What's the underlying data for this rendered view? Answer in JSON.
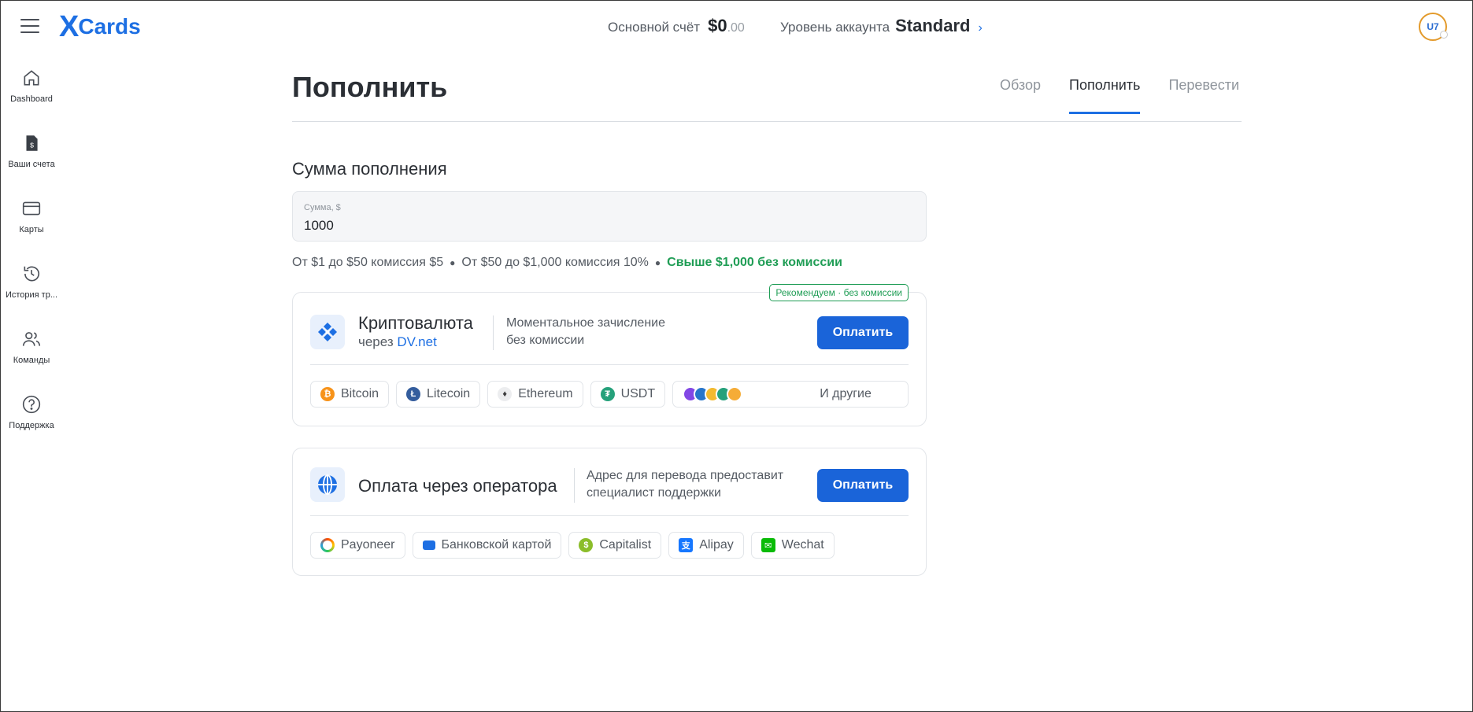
{
  "header": {
    "logo_x": "X",
    "logo_text": "Cards",
    "balance_label": "Основной счёт",
    "balance_amount": "$0",
    "balance_cents": ".00",
    "level_label": "Уровень аккаунта",
    "level_value": "Standard",
    "avatar": "U7"
  },
  "sidebar": {
    "items": [
      {
        "label": "Dashboard",
        "icon": "home-icon"
      },
      {
        "label": "Ваши счета",
        "icon": "invoice-icon"
      },
      {
        "label": "Карты",
        "icon": "card-icon"
      },
      {
        "label": "История тр...",
        "icon": "history-icon"
      },
      {
        "label": "Команды",
        "icon": "team-icon"
      },
      {
        "label": "Поддержка",
        "icon": "help-icon"
      }
    ]
  },
  "page": {
    "title": "Пополнить",
    "tabs": [
      {
        "label": "Обзор",
        "active": false
      },
      {
        "label": "Пополнить",
        "active": true
      },
      {
        "label": "Перевести",
        "active": false
      }
    ]
  },
  "amount": {
    "section_title": "Сумма пополнения",
    "field_label": "Сумма, $",
    "field_value": "1000",
    "fee_1": "От $1 до $50 комиссия $5",
    "fee_2": "От $50 до $1,000 комиссия 10%",
    "fee_3": "Свыше $1,000 без комиссии"
  },
  "crypto": {
    "badge": "Рекомендуем · без комиссии",
    "title": "Криптовалюта",
    "via": "через",
    "via_link": "DV.net",
    "desc_1": "Моментальное зачисление",
    "desc_2": "без комиссии",
    "button": "Оплатить",
    "chips": [
      "Bitcoin",
      "Litecoin",
      "Ethereum",
      "USDT"
    ],
    "more": "И другие"
  },
  "operator": {
    "title": "Оплата через оператора",
    "desc_1": "Адрес для перевода предоставит",
    "desc_2": "специалист поддержки",
    "button": "Оплатить",
    "chips": [
      "Payoneer",
      "Банковской картой",
      "Capitalist",
      "Alipay",
      "Wechat"
    ]
  },
  "colors": {
    "accent": "#1d6fe3",
    "button": "#1a64d9",
    "success": "#1f9d55",
    "bitcoin": "#f7931a",
    "litecoin": "#345d9d",
    "usdt": "#26a17b"
  }
}
